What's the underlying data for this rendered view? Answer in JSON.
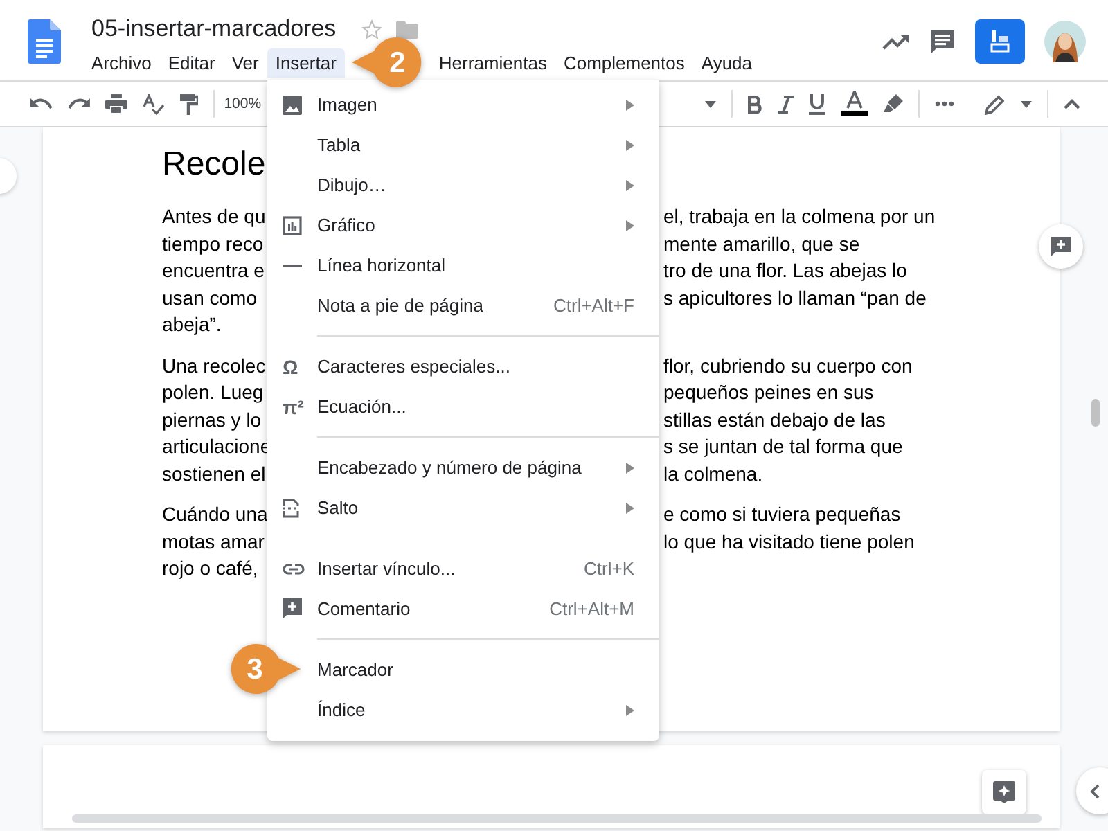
{
  "document_title": "05-insertar-marcadores",
  "menubar": [
    {
      "label": "Archivo",
      "selected": false
    },
    {
      "label": "Editar",
      "selected": false
    },
    {
      "label": "Ver",
      "selected": false
    },
    {
      "label": "Insertar",
      "selected": true
    },
    {
      "label": "Herramientas",
      "selected": false
    },
    {
      "label": "Complementos",
      "selected": false
    },
    {
      "label": "Ayuda",
      "selected": false
    }
  ],
  "toolbar": {
    "zoom": "100%"
  },
  "document": {
    "heading": "Recole",
    "paragraphs": [
      {
        "lines": [
          {
            "left": "Antes de qu",
            "right": "el, trabaja en la colmena por un"
          },
          {
            "left": "tiempo reco",
            "right": "mente amarillo, que se"
          },
          {
            "left": "encuentra e",
            "right": "tro de una flor. Las abejas lo"
          },
          {
            "left": "usan como",
            "right": "s apicultores lo llaman “pan de"
          },
          {
            "left": "abeja”."
          }
        ]
      },
      {
        "lines": [
          {
            "left": "Una recolec",
            "right": "flor, cubriendo su cuerpo con"
          },
          {
            "left": "polen. Lueg",
            "right": "pequeños peines en sus"
          },
          {
            "left": "piernas y lo",
            "right": "stillas están debajo de las"
          },
          {
            "left": "articulacione",
            "right": "s se juntan de tal forma que"
          },
          {
            "left": "sostienen el",
            "right": "la colmena."
          }
        ]
      },
      {
        "lines": [
          {
            "left": "Cuándo una",
            "right": "e como si tuviera pequeñas"
          },
          {
            "left": "motas amar",
            "right": "lo que ha visitado tiene polen"
          },
          {
            "left": "rojo o café,"
          }
        ]
      }
    ]
  },
  "menu": [
    {
      "kind": "item",
      "label": "Imagen",
      "submenu": true
    },
    {
      "kind": "item",
      "label": "Tabla",
      "submenu": true
    },
    {
      "kind": "item",
      "label": "Dibujo…",
      "submenu": true
    },
    {
      "kind": "item",
      "label": "Gráfico",
      "submenu": true
    },
    {
      "kind": "item",
      "label": "Línea horizontal",
      "submenu": false
    },
    {
      "kind": "item",
      "label": "Nota a pie de página",
      "shortcut": "Ctrl+Alt+F",
      "submenu": false
    },
    {
      "kind": "separator"
    },
    {
      "kind": "item",
      "label": "Caracteres especiales...",
      "glyph": "Ω",
      "submenu": false
    },
    {
      "kind": "item",
      "label": "Ecuación...",
      "glyph": "π²",
      "submenu": false
    },
    {
      "kind": "separator"
    },
    {
      "kind": "item",
      "label": "Encabezado y número de página",
      "submenu": true
    },
    {
      "kind": "item",
      "label": "Salto",
      "submenu": true
    },
    {
      "kind": "spacer"
    },
    {
      "kind": "item",
      "label": "Insertar vínculo...",
      "shortcut": "Ctrl+K",
      "submenu": false
    },
    {
      "kind": "item",
      "label": "Comentario",
      "shortcut": "Ctrl+Alt+M",
      "submenu": false
    },
    {
      "kind": "separator"
    },
    {
      "kind": "item",
      "label": "Marcador",
      "submenu": false
    },
    {
      "kind": "item",
      "label": "Índice",
      "submenu": true
    }
  ],
  "callouts": [
    {
      "number": "2"
    },
    {
      "number": "3"
    }
  ]
}
